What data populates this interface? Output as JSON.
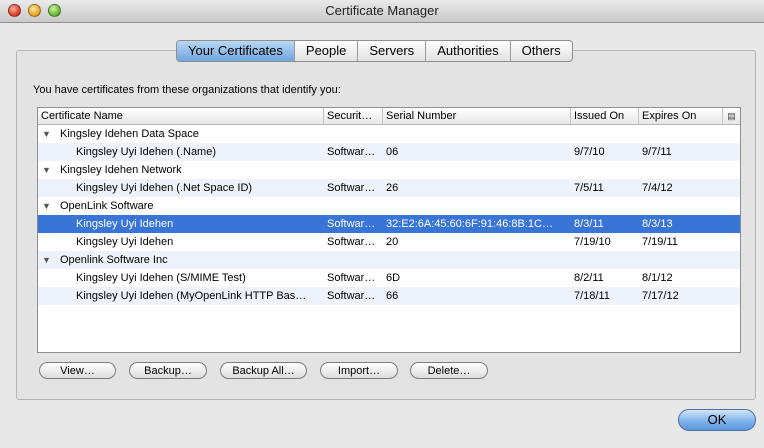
{
  "window": {
    "title": "Certificate Manager"
  },
  "tabs": [
    {
      "label": "Your Certificates"
    },
    {
      "label": "People"
    },
    {
      "label": "Servers"
    },
    {
      "label": "Authorities"
    },
    {
      "label": "Others"
    }
  ],
  "intro_text": "You have certificates from these organizations that identify you:",
  "columns": {
    "name": "Certificate Name",
    "security": "Securit…",
    "serial": "Serial Number",
    "issued": "Issued On",
    "expires": "Expires On",
    "picker_icon": "column-picker-icon"
  },
  "groups": [
    {
      "label": "Kingsley Idehen Data Space",
      "certs": [
        {
          "name": "Kingsley Uyi Idehen (.Name)",
          "security": "Softwar…",
          "serial": "06",
          "issued": "9/7/10",
          "expires": "9/7/11"
        }
      ]
    },
    {
      "label": "Kingsley Idehen Network",
      "certs": [
        {
          "name": "Kingsley Uyi Idehen (.Net Space ID)",
          "security": "Softwar…",
          "serial": "26",
          "issued": "7/5/11",
          "expires": "7/4/12"
        }
      ]
    },
    {
      "label": "OpenLink Software",
      "certs": [
        {
          "name": "Kingsley Uyi Idehen",
          "security": "Softwar…",
          "serial": "32:E2:6A:45:60:6F:91:46:8B:1C…",
          "issued": "8/3/11",
          "expires": "8/3/13",
          "selected": true
        },
        {
          "name": "Kingsley Uyi Idehen",
          "security": "Softwar…",
          "serial": "20",
          "issued": "7/19/10",
          "expires": "7/19/11"
        }
      ]
    },
    {
      "label": "Openlink Software Inc",
      "certs": [
        {
          "name": "Kingsley Uyi Idehen (S/MIME Test)",
          "security": "Softwar…",
          "serial": "6D",
          "issued": "8/2/11",
          "expires": "8/1/12"
        },
        {
          "name": "Kingsley Uyi Idehen (MyOpenLink HTTP Bas…",
          "security": "Softwar…",
          "serial": "66",
          "issued": "7/18/11",
          "expires": "7/17/12"
        }
      ]
    }
  ],
  "buttons": {
    "view": "View…",
    "backup": "Backup…",
    "backup_all": "Backup All…",
    "import": "Import…",
    "delete": "Delete…",
    "ok": "OK"
  },
  "colors": {
    "selection": "#3875d7",
    "active_tab": "#6fa6de"
  }
}
